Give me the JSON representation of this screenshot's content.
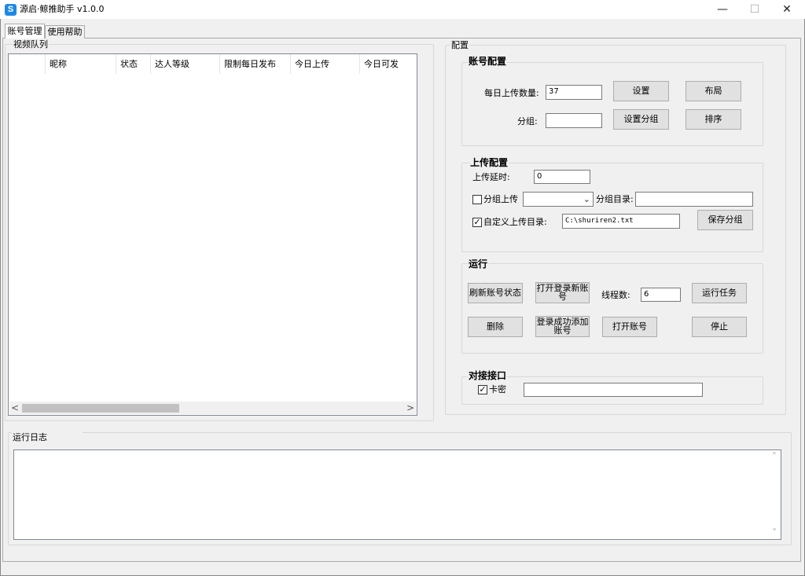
{
  "window": {
    "title": "源启·鲸推助手  v1.0.0",
    "app_icon": "S",
    "minimize": "—",
    "maximize": "☐",
    "close": "✕"
  },
  "tabs": [
    {
      "label": "账号管理",
      "active": true
    },
    {
      "label": "使用帮助",
      "active": false
    }
  ],
  "video_queue": {
    "title": "视频队列",
    "columns": [
      "",
      "昵称",
      "状态",
      "达人等级",
      "限制每日发布",
      "今日上传",
      "今日可发"
    ],
    "rows": [],
    "scroll_left": "<",
    "scroll_right": ">"
  },
  "config": {
    "title": "配置",
    "account": {
      "title": "账号配置",
      "daily_upload_label": "每日上传数量:",
      "daily_upload_value": "37",
      "group_label": "分组:",
      "group_value": "",
      "set_button": "设置",
      "layout_button": "布局",
      "set_group_button": "设置分组",
      "sort_button": "排序"
    },
    "upload": {
      "title": "上传配置",
      "delay_label": "上传延时:",
      "delay_value": "0",
      "group_upload_label": "分组上传",
      "group_upload_checked": false,
      "group_dir_label": "分组目录:",
      "group_dir_value": "",
      "custom_dir_label": "自定义上传目录:",
      "custom_dir_checked": true,
      "custom_dir_value": "C:\\shuriren2.txt",
      "save_group_button": "保存分组",
      "check_mark": "✓",
      "combo_arrow": "⌄"
    },
    "run": {
      "title": "运行",
      "refresh_button": "刷新账号状态",
      "open_login_button": "打开登录新账号",
      "threads_label": "线程数:",
      "threads_value": "6",
      "run_task_button": "运行任务",
      "delete_button": "删除",
      "login_add_button": "登录成功添加账号",
      "open_account_button": "打开账号",
      "stop_button": "停止"
    },
    "api": {
      "title": "对接接口",
      "card_label": "卡密",
      "card_checked": true,
      "card_value": ""
    }
  },
  "log": {
    "title": "运行日志",
    "content": "",
    "scroll_up": "˄",
    "scroll_down": "˅"
  }
}
